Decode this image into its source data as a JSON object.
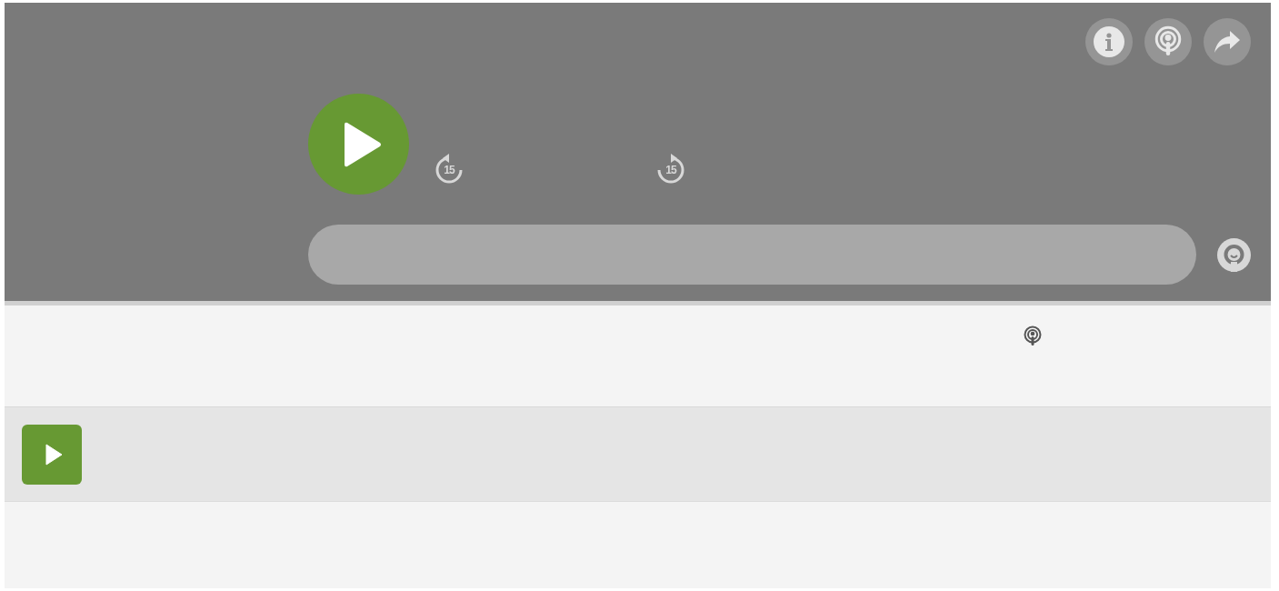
{
  "player": {
    "skip_back": {
      "label": "15"
    },
    "skip_forward": {
      "label": "15"
    }
  }
}
